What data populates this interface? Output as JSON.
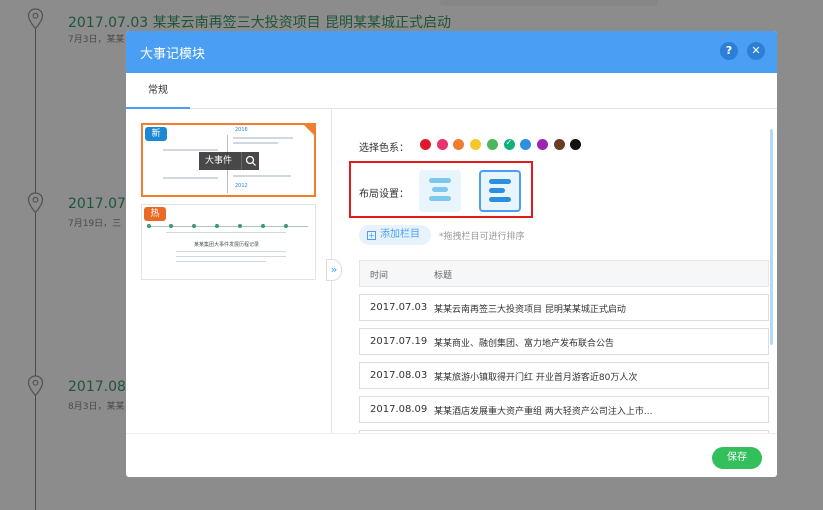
{
  "background": {
    "events": [
      {
        "title": "2017.07.03  某某云南再签三大投资项目 昆明某某城正式启动",
        "sub": "7月3日，某某"
      },
      {
        "title": "2017.07.",
        "sub": "7月19日，三"
      },
      {
        "title": "2017.08.",
        "sub": "8月3日，某某"
      }
    ]
  },
  "modal": {
    "title": "大事记模块",
    "help_label": "?",
    "close_label": "✕",
    "tab_label": "常规"
  },
  "templates": {
    "new_badge": "新",
    "hot_badge": "热",
    "overlay_label": "大事件",
    "mini_year_1": "2016",
    "mini_year_2": "2012",
    "mini_caption": "某某集团大事件发展历程记录"
  },
  "settings": {
    "color_label": "选择色系：",
    "colors": [
      "#e0182d",
      "#e8336e",
      "#f07e2f",
      "#f5c82a",
      "#4bb85f",
      "#14b07a",
      "#2d8fe0",
      "#9b27b0",
      "#6a3b27",
      "#111111"
    ],
    "selected_color_index": 5,
    "layout_label": "布局设置：",
    "add_button": "添加栏目",
    "add_plus": "+",
    "hint": "*拖拽栏目可进行排序"
  },
  "table": {
    "headers": {
      "time": "时间",
      "title": "标题"
    },
    "rows": [
      {
        "date": "2017.07.03",
        "title": "某某云南再签三大投资项目 昆明某某城正式启动"
      },
      {
        "date": "2017.07.19",
        "title": "某某商业、融创集团、富力地产发布联合公告"
      },
      {
        "date": "2017.08.03",
        "title": "某某旅游小镇取得开门红 开业首月游客近80万人次"
      },
      {
        "date": "2017.08.09",
        "title": "某某酒店发展重大资产重组 两大轻资产公司注入上市..."
      }
    ]
  },
  "footer": {
    "save_label": "保存"
  }
}
